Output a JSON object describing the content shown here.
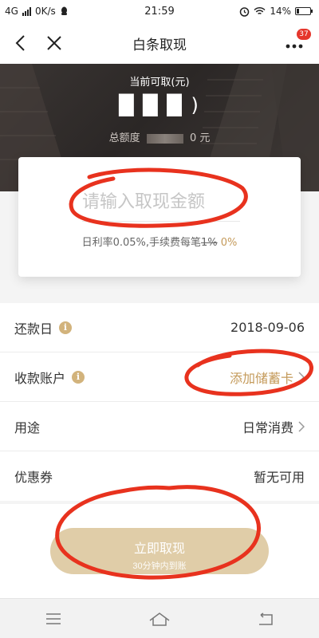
{
  "status_bar": {
    "network": "4G",
    "speed": "0K/s",
    "time": "21:59",
    "battery": "14%"
  },
  "nav": {
    "title": "白条取现",
    "more_badge": "37"
  },
  "hero": {
    "label": "当前可取(元)",
    "amount_masked": "█ █ █ )",
    "total_prefix": "总额度",
    "total_suffix": "0 元"
  },
  "withdraw_card": {
    "placeholder": "请输入取现金额",
    "rate_text": "日利率0.05%,手续费每笔",
    "old_fee": "1%",
    "new_fee": "0%"
  },
  "rows": [
    {
      "label": "还款日",
      "value": "2018-09-06",
      "has_info": true,
      "has_chevron": false,
      "gold": false
    },
    {
      "label": "收款账户",
      "value": "添加储蓄卡",
      "has_info": true,
      "has_chevron": true,
      "gold": true
    },
    {
      "label": "用途",
      "value": "日常消费",
      "has_info": false,
      "has_chevron": true,
      "gold": false
    },
    {
      "label": "优惠券",
      "value": "暂无可用",
      "has_info": false,
      "has_chevron": false,
      "gold": false
    }
  ],
  "submit": {
    "title": "立即取现",
    "subtitle": "30分钟内到账"
  },
  "colors": {
    "accent_gold": "#c49a5a",
    "button": "#e0cda8",
    "badge": "#e5362c",
    "annotation": "#e8321e"
  }
}
